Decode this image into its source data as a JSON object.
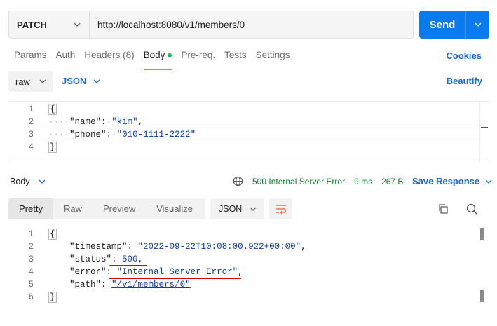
{
  "request": {
    "method": "PATCH",
    "url": "http://localhost:8080/v1/members/0",
    "send_label": "Send"
  },
  "request_tabs": [
    {
      "label": "Params"
    },
    {
      "label": "Auth"
    },
    {
      "label": "Headers (8)"
    },
    {
      "label": "Body"
    },
    {
      "label": "Pre-req."
    },
    {
      "label": "Tests"
    },
    {
      "label": "Settings"
    }
  ],
  "cookies_label": "Cookies",
  "body_mode": "raw",
  "body_format": "JSON",
  "beautify_label": "Beautify",
  "request_body": {
    "line_numbers": [
      "1",
      "2",
      "3",
      "4"
    ],
    "open_brace": "{",
    "close_brace": "}",
    "name_key": "\"name\"",
    "name_val": "\"kim\"",
    "phone_key": "\"phone\"",
    "phone_val": "\"010-1111-2222\""
  },
  "response": {
    "section_label": "Body",
    "status": "500 Internal Server Error",
    "time": "9 ms",
    "size": "267 B",
    "save_label": "Save Response",
    "view_tabs": [
      {
        "label": "Pretty"
      },
      {
        "label": "Raw"
      },
      {
        "label": "Preview"
      },
      {
        "label": "Visualize"
      }
    ],
    "format": "JSON",
    "body": {
      "line_numbers": [
        "1",
        "2",
        "3",
        "4",
        "5",
        "6"
      ],
      "open_brace": "{",
      "close_brace": "}",
      "timestamp_key": "\"timestamp\"",
      "timestamp_val": "\"2022-09-22T10:08:00.922+00:00\"",
      "status_key": "\"status\"",
      "status_val": "500",
      "error_key": "\"error\"",
      "error_val": "\"Internal Server Error\"",
      "path_key": "\"path\"",
      "path_val": "\"/v1/members/0\""
    }
  },
  "colors": {
    "accent": "#097bed",
    "link": "#1a6bd8",
    "status_green": "#0f7a3a",
    "annotation_red": "#e00000",
    "active_tab_underline": "#ff6c37"
  },
  "icons": [
    "chevron-down-icon",
    "globe-icon",
    "wrap-icon",
    "copy-icon",
    "search-icon"
  ]
}
